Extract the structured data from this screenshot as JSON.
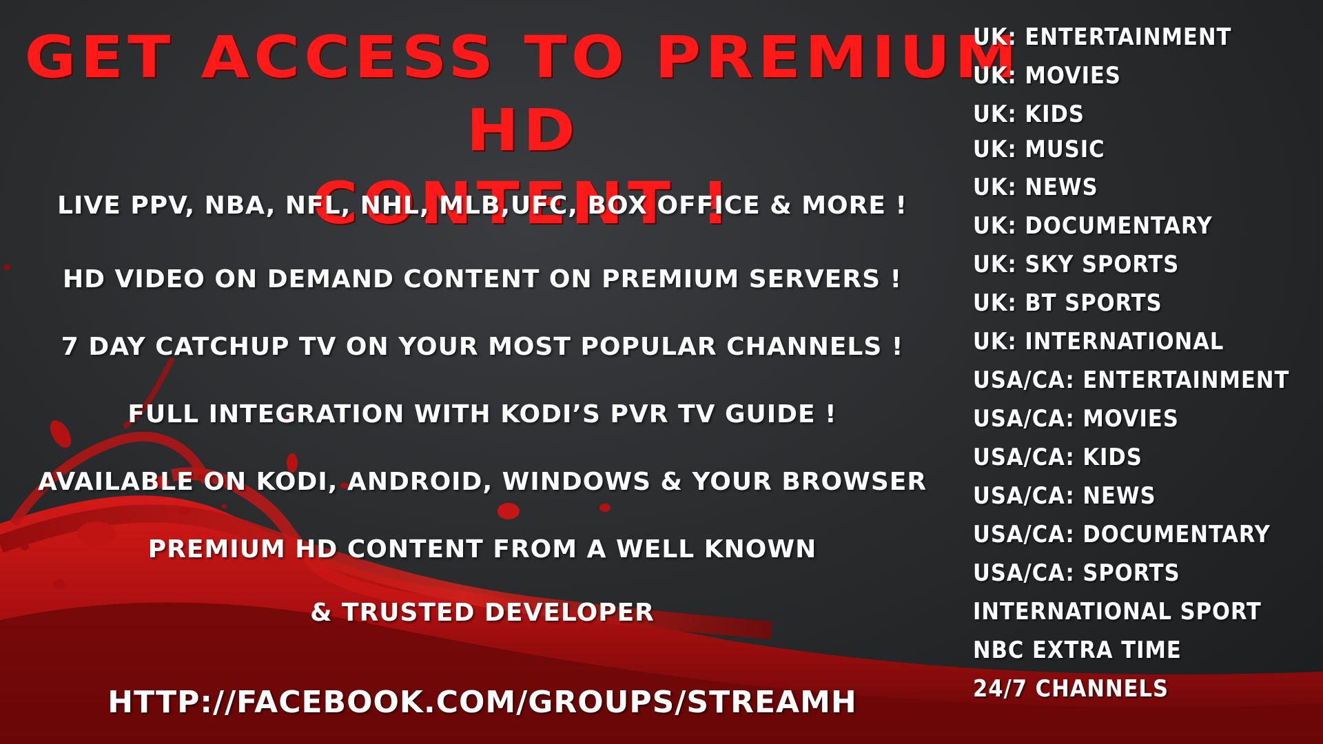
{
  "headline": [
    "GET ACCESS TO PREMIUM HD",
    "CONTENT !"
  ],
  "features": [
    "LIVE PPV, NBA, NFL, NHL, MLB,UFC, BOX OFFICE & MORE !",
    "HD VIDEO ON DEMAND CONTENT ON PREMIUM SERVERS !",
    "7 DAY CATCHUP TV ON YOUR MOST POPULAR CHANNELS !",
    "FULL INTEGRATION WITH KODI’S PVR TV GUIDE !",
    "AVAILABLE ON KODI, ANDROID, WINDOWS & YOUR  BROWSER",
    "PREMIUM HD CONTENT FROM A WELL KNOWN",
    "& TRUSTED DEVELOPER"
  ],
  "link": "HTTP://FACEBOOK.COM/GROUPS/STREAMH",
  "channels": [
    "UK: ENTERTAINMENT",
    "UK: MOVIES",
    "UK: KIDS",
    "UK: MUSIC",
    "UK: NEWS",
    "UK: DOCUMENTARY",
    "UK: SKY SPORTS",
    "UK: BT SPORTS",
    "UK: INTERNATIONAL",
    "USA/CA: ENTERTAINMENT",
    "USA/CA: MOVIES",
    "USA/CA: KIDS",
    "USA/CA: NEWS",
    "USA/CA: DOCUMENTARY",
    "USA/CA: SPORTS",
    "INTERNATIONAL SPORT",
    "NBC EXTRA TIME",
    "24/7 CHANNELS"
  ],
  "colors": {
    "headline": "#ff1a1a",
    "text": "#ffffff",
    "background": "#2a2c2e",
    "splash": "#c81414"
  }
}
